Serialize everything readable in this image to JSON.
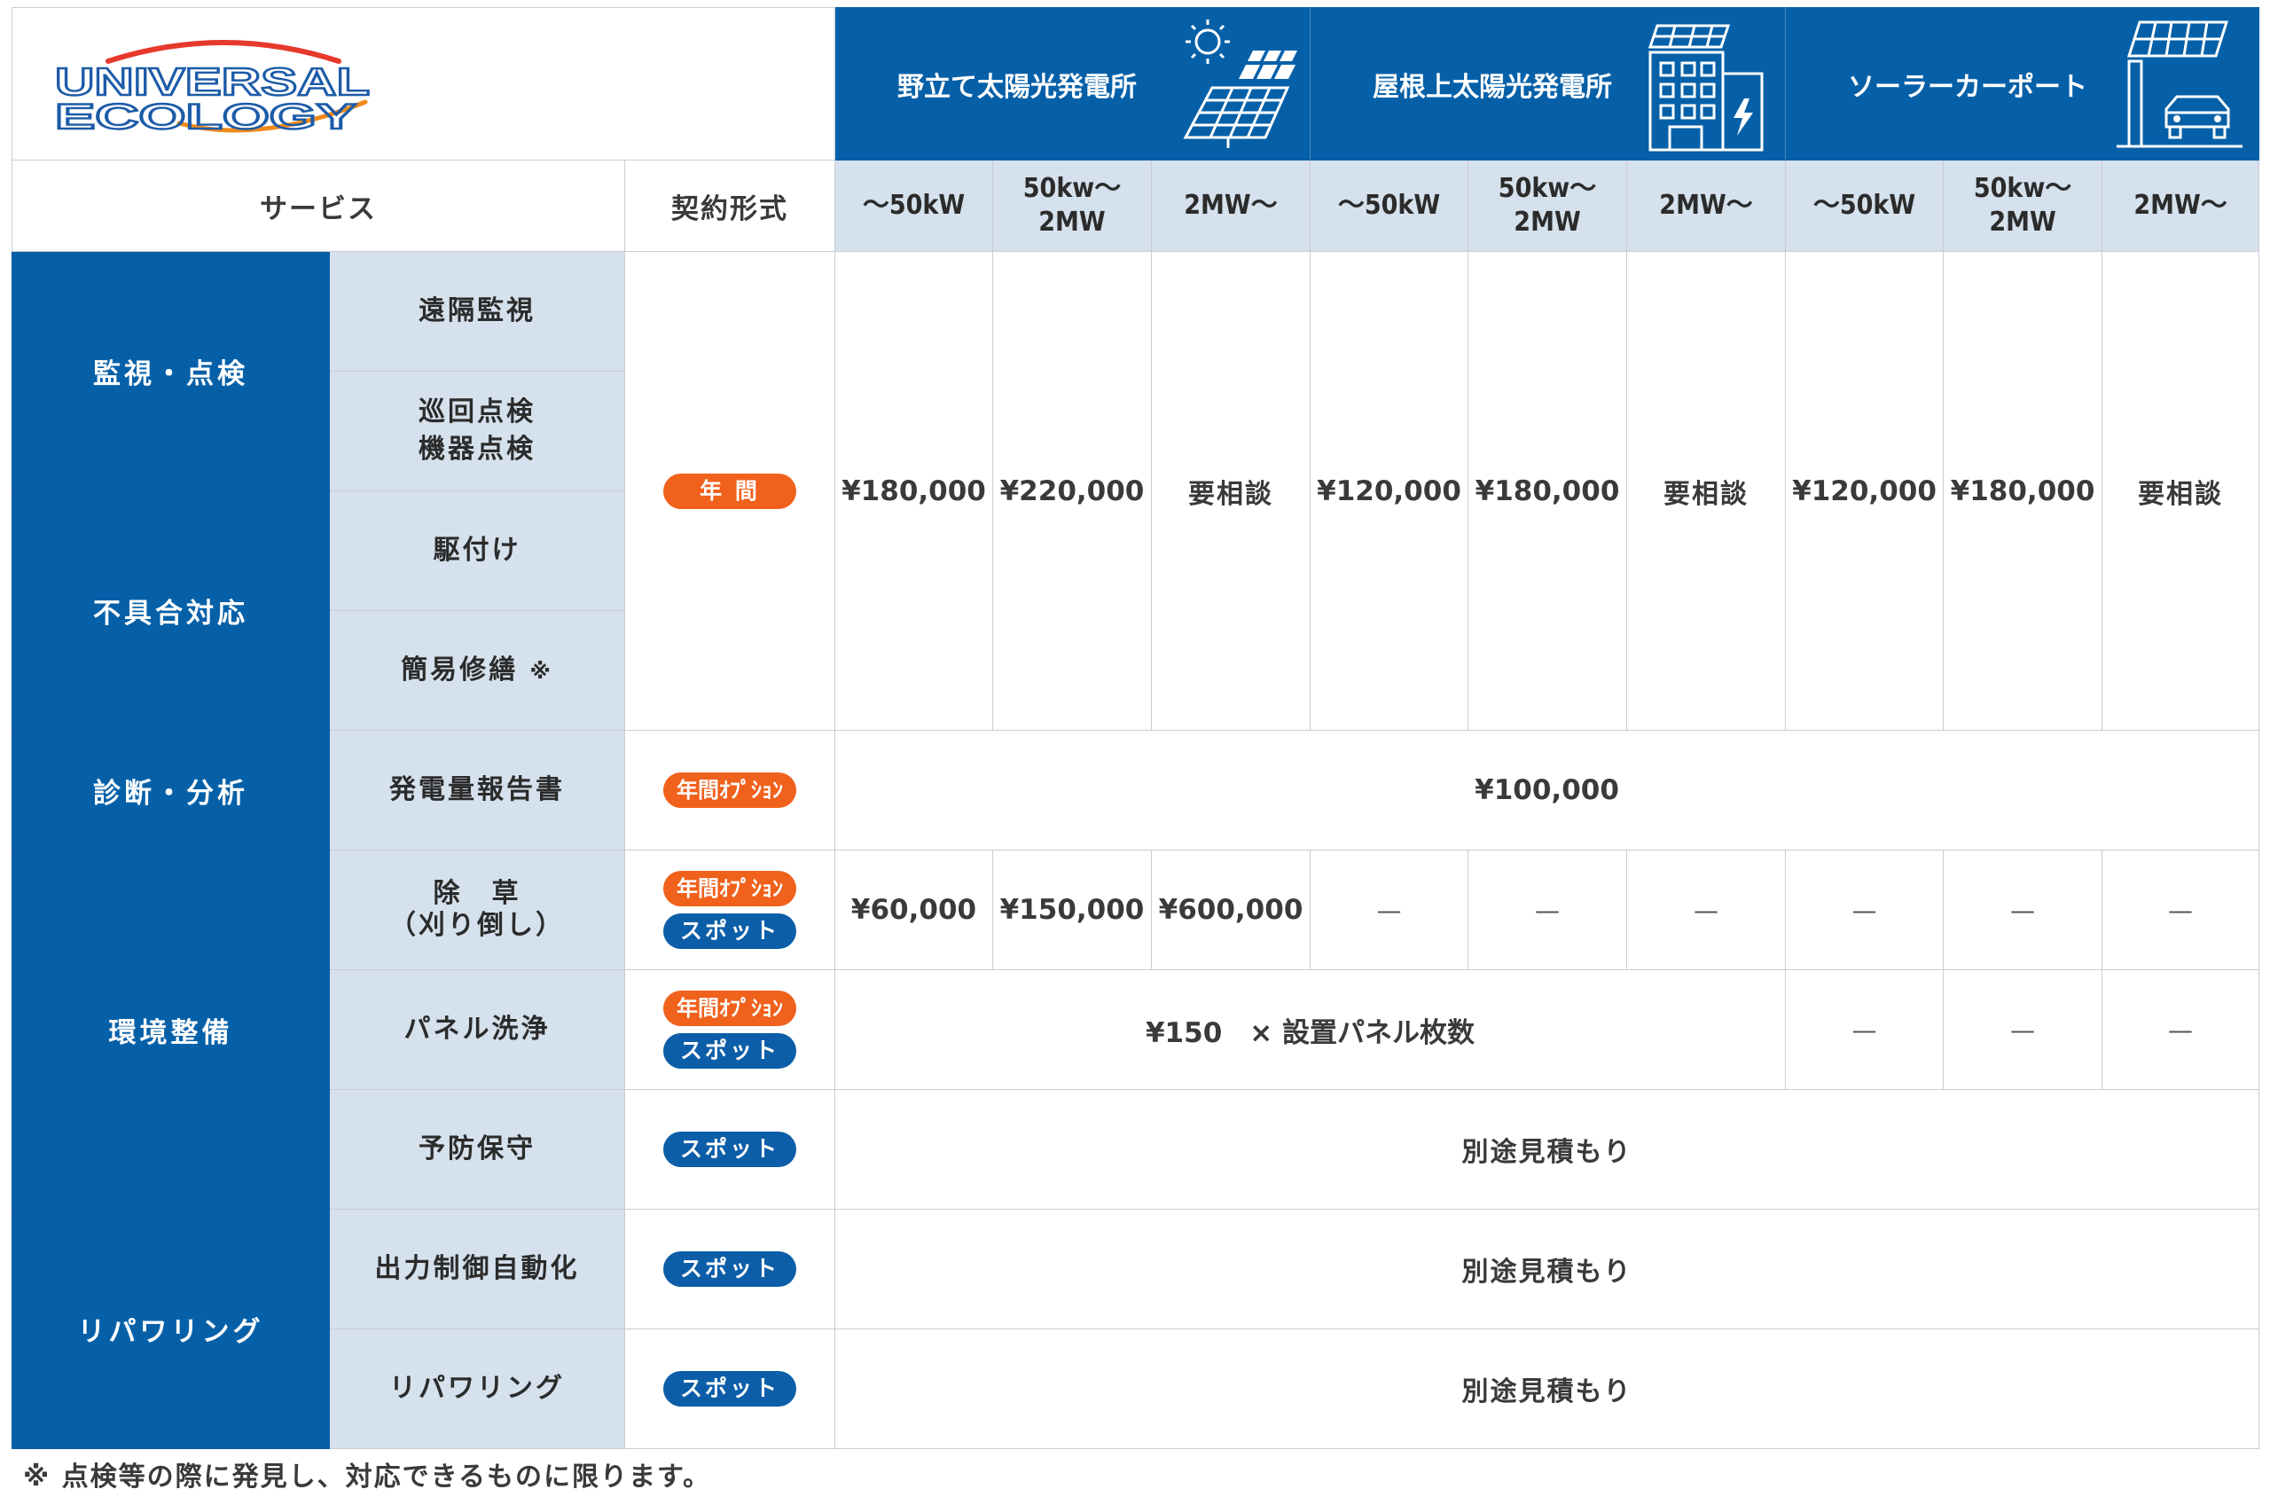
{
  "logo": {
    "line1": "UNIVERSAL",
    "line2": "ECOLOGY"
  },
  "sites": [
    {
      "label": "野立て太陽光発電所",
      "icon": "solar-panel-sun-icon"
    },
    {
      "label": "屋根上太陽光発電所",
      "icon": "building-solar-icon"
    },
    {
      "label": "ソーラーカーポート",
      "icon": "carport-solar-icon"
    }
  ],
  "headers": {
    "service": "サービス",
    "contract": "契約形式",
    "capacity": [
      "〜50kW",
      "50kw〜",
      "2MW",
      "2MW〜"
    ]
  },
  "categories": {
    "monitoring": "監視・点検",
    "failure": "不具合対応",
    "diagnosis": "診断・分析",
    "environment": "環境整備",
    "repowering": "リパワリング"
  },
  "services": {
    "remote": "遠隔監視",
    "patrol1": "巡回点検",
    "patrol2": "機器点検",
    "rush": "駆付け",
    "repair": "簡易修繕",
    "repair_mark": "※",
    "report": "発電量報告書",
    "weed1": "除　草",
    "weed2": "（刈り倒し）",
    "panel": "パネル洗浄",
    "preventive": "予防保守",
    "output": "出力制御自動化",
    "repower": "リパワリング"
  },
  "contracts": {
    "annual": "年 間",
    "annual_option": "年間ｵﾌﾟｼｮﾝ",
    "spot": "スポット"
  },
  "prices": {
    "basic": [
      "¥180,000",
      "¥220,000",
      "要相談",
      "¥120,000",
      "¥180,000",
      "要相談",
      "¥120,000",
      "¥180,000",
      "要相談"
    ],
    "report": "¥100,000",
    "weed": [
      "¥60,000",
      "¥150,000",
      "¥600,000",
      "—",
      "—",
      "—",
      "—",
      "—",
      "—"
    ],
    "panel_main": "¥150　× 設置パネル枚数",
    "panel_dash": [
      "—",
      "—",
      "—"
    ],
    "estimate": "別途見積もり"
  },
  "footnote": "※ 点検等の際に発見し、対応できるものに限ります。",
  "colors": {
    "brand_blue": "#0560a8",
    "light_blue": "#d5e1ec",
    "orange": "#f0611c"
  }
}
